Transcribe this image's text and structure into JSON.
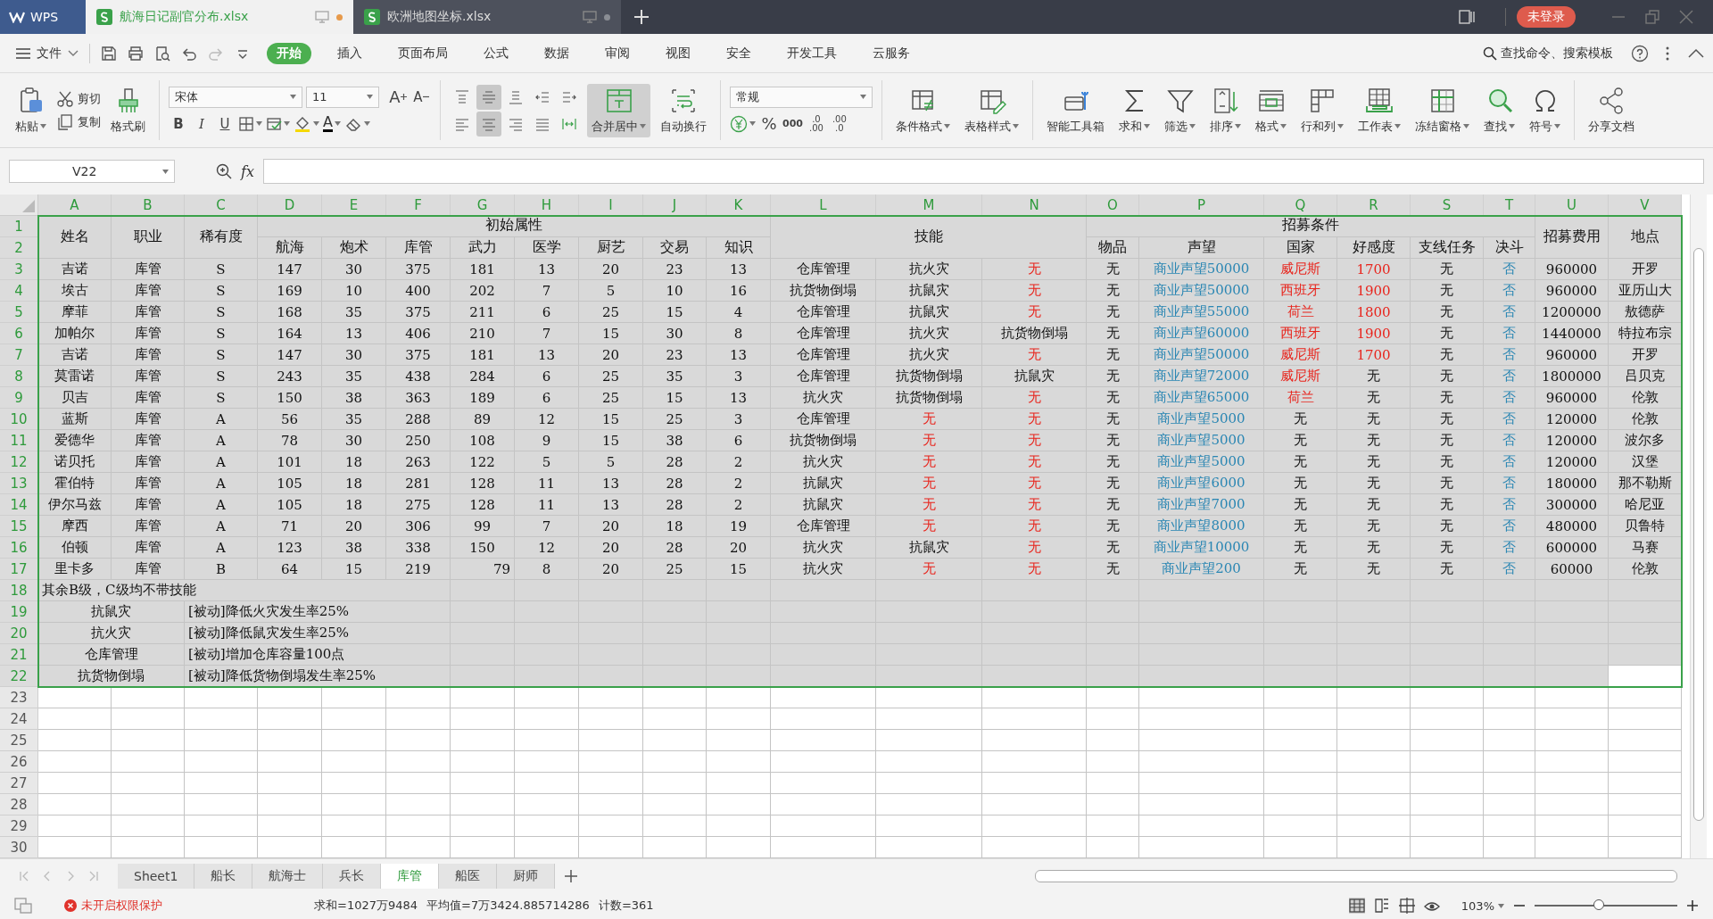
{
  "title_bar": {
    "app": "WPS",
    "tabs": [
      {
        "label": "航海日记副官分布.xlsx",
        "selected": true,
        "unsaved": true
      },
      {
        "label": "欧洲地图坐标.xlsx",
        "selected": false,
        "unsaved": false
      }
    ],
    "login": "未登录"
  },
  "menu_bar": {
    "file": "文件",
    "tabs": [
      {
        "label": "开始",
        "selected": true
      },
      {
        "label": "插入",
        "selected": false
      },
      {
        "label": "页面布局",
        "selected": false
      },
      {
        "label": "公式",
        "selected": false
      },
      {
        "label": "数据",
        "selected": false
      },
      {
        "label": "审阅",
        "selected": false
      },
      {
        "label": "视图",
        "selected": false
      },
      {
        "label": "安全",
        "selected": false
      },
      {
        "label": "开发工具",
        "selected": false
      },
      {
        "label": "云服务",
        "selected": false
      }
    ],
    "search": "查找命令、搜索模板"
  },
  "ribbon": {
    "paste": "粘贴",
    "cut": "剪切",
    "copy": "复制",
    "format_painter": "格式刷",
    "font": "宋体",
    "font_size": "11",
    "grow_font": "A",
    "shrink_font": "A",
    "styles": [
      {
        "label": "B",
        "kind": "bold"
      },
      {
        "label": "I",
        "kind": "italic"
      },
      {
        "label": "U",
        "kind": "underline"
      }
    ],
    "font_color": "A",
    "alignment": [
      {
        "kind": "top",
        "selected": false
      },
      {
        "kind": "middle",
        "selected": true
      },
      {
        "kind": "bottom",
        "selected": false
      },
      {
        "kind": "outdent",
        "selected": false
      },
      {
        "kind": "indent",
        "selected": false
      },
      {
        "kind": "left",
        "selected": false
      },
      {
        "kind": "center",
        "selected": true
      },
      {
        "kind": "right",
        "selected": false
      },
      {
        "kind": "justify",
        "selected": false
      },
      {
        "kind": "distributed",
        "selected": false
      }
    ],
    "merge": {
      "label": "合并居中",
      "selected": true
    },
    "wrap": {
      "label": "自动换行",
      "selected": false
    },
    "number_format": "常规",
    "percent": "%",
    "thousands": "000",
    "decimals": [
      {
        "top": ".0",
        "bottom": ".00"
      },
      {
        "top": ".00",
        "bottom": ".0"
      }
    ],
    "tools": [
      {
        "label": "条件格式",
        "kind": "conditional",
        "has_menu": true
      },
      {
        "label": "表格样式",
        "kind": "table_style",
        "has_menu": true
      },
      {
        "label": "智能工具箱",
        "kind": "toolbox",
        "has_menu": false
      },
      {
        "label": "求和",
        "kind": "sum",
        "has_menu": true
      },
      {
        "label": "筛选",
        "kind": "filter",
        "has_menu": true
      },
      {
        "label": "排序",
        "kind": "sort",
        "has_menu": true
      },
      {
        "label": "格式",
        "kind": "format",
        "has_menu": true
      },
      {
        "label": "行和列",
        "kind": "rows_cols",
        "has_menu": true
      },
      {
        "label": "工作表",
        "kind": "worksheet",
        "has_menu": true
      },
      {
        "label": "冻结窗格",
        "kind": "freeze",
        "has_menu": true
      },
      {
        "label": "查找",
        "kind": "find",
        "has_menu": true
      },
      {
        "label": "符号",
        "kind": "symbol",
        "has_menu": true
      },
      {
        "label": "分享文档",
        "kind": "share",
        "has_menu": false
      }
    ]
  },
  "formula_bar": {
    "cell": "V22",
    "fx": "fx"
  },
  "sheet": {
    "columns": [
      {
        "letter": "A",
        "selected": true
      },
      {
        "letter": "B",
        "selected": true
      },
      {
        "letter": "C",
        "selected": true
      },
      {
        "letter": "D",
        "selected": true
      },
      {
        "letter": "E",
        "selected": true
      },
      {
        "letter": "F",
        "selected": true
      },
      {
        "letter": "G",
        "selected": true
      },
      {
        "letter": "H",
        "selected": true
      },
      {
        "letter": "I",
        "selected": true
      },
      {
        "letter": "J",
        "selected": true
      },
      {
        "letter": "K",
        "selected": true
      },
      {
        "letter": "L",
        "selected": true
      },
      {
        "letter": "M",
        "selected": true
      },
      {
        "letter": "N",
        "selected": true
      },
      {
        "letter": "O",
        "selected": true
      },
      {
        "letter": "P",
        "selected": true
      },
      {
        "letter": "Q",
        "selected": true
      },
      {
        "letter": "R",
        "selected": true
      },
      {
        "letter": "S",
        "selected": true
      },
      {
        "letter": "T",
        "selected": true
      },
      {
        "letter": "U",
        "selected": true
      },
      {
        "letter": "V",
        "selected": true
      }
    ],
    "rows": [
      {
        "number": "1",
        "selected": true
      },
      {
        "number": "2",
        "selected": true
      },
      {
        "number": "3",
        "selected": true
      },
      {
        "number": "4",
        "selected": true
      },
      {
        "number": "5",
        "selected": true
      },
      {
        "number": "6",
        "selected": true
      },
      {
        "number": "7",
        "selected": true
      },
      {
        "number": "8",
        "selected": true
      },
      {
        "number": "9",
        "selected": true
      },
      {
        "number": "10",
        "selected": true
      },
      {
        "number": "11",
        "selected": true
      },
      {
        "number": "12",
        "selected": true
      },
      {
        "number": "13",
        "selected": true
      },
      {
        "number": "14",
        "selected": true
      },
      {
        "number": "15",
        "selected": true
      },
      {
        "number": "16",
        "selected": true
      },
      {
        "number": "17",
        "selected": true
      },
      {
        "number": "18",
        "selected": true
      },
      {
        "number": "19",
        "selected": true
      },
      {
        "number": "20",
        "selected": true
      },
      {
        "number": "21",
        "selected": true
      },
      {
        "number": "22",
        "selected": true
      },
      {
        "number": "23",
        "selected": false
      },
      {
        "number": "24",
        "selected": false
      },
      {
        "number": "25",
        "selected": false
      },
      {
        "number": "26",
        "selected": false
      },
      {
        "number": "27",
        "selected": false
      },
      {
        "number": "28",
        "selected": false
      },
      {
        "number": "29",
        "selected": false
      },
      {
        "number": "30",
        "selected": false
      }
    ],
    "header_cells": [
      "姓名",
      "职业",
      "稀有度",
      "初始属性",
      "航海",
      "炮术",
      "库管",
      "武力",
      "医学",
      "厨艺",
      "交易",
      "知识",
      "技能",
      "招募条件",
      "物品",
      "声望",
      "国家",
      "好感度",
      "支线任务",
      "决斗",
      "招募费用",
      "地点"
    ],
    "data_rows": [
      [
        {
          "text": "吉诺"
        },
        {
          "text": "库管"
        },
        {
          "text": "S"
        },
        {
          "text": "147"
        },
        {
          "text": "30"
        },
        {
          "text": "375"
        },
        {
          "text": "181"
        },
        {
          "text": "13"
        },
        {
          "text": "20"
        },
        {
          "text": "23"
        },
        {
          "text": "13"
        },
        {
          "text": "仓库管理"
        },
        {
          "text": "抗火灾"
        },
        {
          "text": "无",
          "color": "#e8241c"
        },
        {
          "text": "无"
        },
        {
          "text": "商业声望50000",
          "color": "#2a86b3"
        },
        {
          "text": "威尼斯",
          "color": "#e8241c"
        },
        {
          "text": "1700",
          "color": "#e8241c"
        },
        {
          "text": "无"
        },
        {
          "text": "否",
          "color": "#2a86b3"
        },
        {
          "text": "960000"
        },
        {
          "text": "开罗"
        }
      ],
      [
        {
          "text": "埃古"
        },
        {
          "text": "库管"
        },
        {
          "text": "S"
        },
        {
          "text": "169"
        },
        {
          "text": "10"
        },
        {
          "text": "400"
        },
        {
          "text": "202"
        },
        {
          "text": "7"
        },
        {
          "text": "5"
        },
        {
          "text": "10"
        },
        {
          "text": "16"
        },
        {
          "text": "抗货物倒塌"
        },
        {
          "text": "抗鼠灾"
        },
        {
          "text": "无",
          "color": "#e8241c"
        },
        {
          "text": "无"
        },
        {
          "text": "商业声望50000",
          "color": "#2a86b3"
        },
        {
          "text": "西班牙",
          "color": "#e8241c"
        },
        {
          "text": "1900",
          "color": "#e8241c"
        },
        {
          "text": "无"
        },
        {
          "text": "否",
          "color": "#2a86b3"
        },
        {
          "text": "960000"
        },
        {
          "text": "亚历山大"
        }
      ],
      [
        {
          "text": "摩菲"
        },
        {
          "text": "库管"
        },
        {
          "text": "S"
        },
        {
          "text": "168"
        },
        {
          "text": "35"
        },
        {
          "text": "375"
        },
        {
          "text": "211"
        },
        {
          "text": "6"
        },
        {
          "text": "25"
        },
        {
          "text": "15"
        },
        {
          "text": "4"
        },
        {
          "text": "仓库管理"
        },
        {
          "text": "抗鼠灾"
        },
        {
          "text": "无",
          "color": "#e8241c"
        },
        {
          "text": "无"
        },
        {
          "text": "商业声望55000",
          "color": "#2a86b3"
        },
        {
          "text": "荷兰",
          "color": "#e8241c"
        },
        {
          "text": "1800",
          "color": "#e8241c"
        },
        {
          "text": "无"
        },
        {
          "text": "否",
          "color": "#2a86b3"
        },
        {
          "text": "1200000"
        },
        {
          "text": "敖德萨"
        }
      ],
      [
        {
          "text": "加帕尔"
        },
        {
          "text": "库管"
        },
        {
          "text": "S"
        },
        {
          "text": "164"
        },
        {
          "text": "13"
        },
        {
          "text": "406"
        },
        {
          "text": "210"
        },
        {
          "text": "7"
        },
        {
          "text": "15"
        },
        {
          "text": "30"
        },
        {
          "text": "8"
        },
        {
          "text": "仓库管理"
        },
        {
          "text": "抗火灾"
        },
        {
          "text": "抗货物倒塌"
        },
        {
          "text": "无"
        },
        {
          "text": "商业声望60000",
          "color": "#2a86b3"
        },
        {
          "text": "西班牙",
          "color": "#e8241c"
        },
        {
          "text": "1900",
          "color": "#e8241c"
        },
        {
          "text": "无"
        },
        {
          "text": "否",
          "color": "#2a86b3"
        },
        {
          "text": "1440000"
        },
        {
          "text": "特拉布宗"
        }
      ],
      [
        {
          "text": "吉诺"
        },
        {
          "text": "库管"
        },
        {
          "text": "S"
        },
        {
          "text": "147"
        },
        {
          "text": "30"
        },
        {
          "text": "375"
        },
        {
          "text": "181"
        },
        {
          "text": "13"
        },
        {
          "text": "20"
        },
        {
          "text": "23"
        },
        {
          "text": "13"
        },
        {
          "text": "仓库管理"
        },
        {
          "text": "抗火灾"
        },
        {
          "text": "无",
          "color": "#e8241c"
        },
        {
          "text": "无"
        },
        {
          "text": "商业声望50000",
          "color": "#2a86b3"
        },
        {
          "text": "威尼斯",
          "color": "#e8241c"
        },
        {
          "text": "1700",
          "color": "#e8241c"
        },
        {
          "text": "无"
        },
        {
          "text": "否",
          "color": "#2a86b3"
        },
        {
          "text": "960000"
        },
        {
          "text": "开罗"
        }
      ],
      [
        {
          "text": "莫雷诺"
        },
        {
          "text": "库管"
        },
        {
          "text": "S"
        },
        {
          "text": "243"
        },
        {
          "text": "35"
        },
        {
          "text": "438"
        },
        {
          "text": "284"
        },
        {
          "text": "6"
        },
        {
          "text": "25"
        },
        {
          "text": "35"
        },
        {
          "text": "3"
        },
        {
          "text": "仓库管理"
        },
        {
          "text": "抗货物倒塌"
        },
        {
          "text": "抗鼠灾"
        },
        {
          "text": "无"
        },
        {
          "text": "商业声望72000",
          "color": "#2a86b3"
        },
        {
          "text": "威尼斯",
          "color": "#e8241c"
        },
        {
          "text": "无"
        },
        {
          "text": "无"
        },
        {
          "text": "否",
          "color": "#2a86b3"
        },
        {
          "text": "1800000"
        },
        {
          "text": "吕贝克"
        }
      ],
      [
        {
          "text": "贝吉"
        },
        {
          "text": "库管"
        },
        {
          "text": "S"
        },
        {
          "text": "150"
        },
        {
          "text": "38"
        },
        {
          "text": "363"
        },
        {
          "text": "189"
        },
        {
          "text": "6"
        },
        {
          "text": "25"
        },
        {
          "text": "15"
        },
        {
          "text": "13"
        },
        {
          "text": "抗火灾"
        },
        {
          "text": "抗货物倒塌"
        },
        {
          "text": "无",
          "color": "#e8241c"
        },
        {
          "text": "无"
        },
        {
          "text": "商业声望65000",
          "color": "#2a86b3"
        },
        {
          "text": "荷兰",
          "color": "#e8241c"
        },
        {
          "text": "无"
        },
        {
          "text": "无"
        },
        {
          "text": "否",
          "color": "#2a86b3"
        },
        {
          "text": "960000"
        },
        {
          "text": "伦敦"
        }
      ],
      [
        {
          "text": "蓝斯"
        },
        {
          "text": "库管"
        },
        {
          "text": "A"
        },
        {
          "text": "56"
        },
        {
          "text": "35"
        },
        {
          "text": "288"
        },
        {
          "text": "89"
        },
        {
          "text": "12"
        },
        {
          "text": "15"
        },
        {
          "text": "25"
        },
        {
          "text": "3"
        },
        {
          "text": "仓库管理"
        },
        {
          "text": "无",
          "color": "#e8241c"
        },
        {
          "text": "无",
          "color": "#e8241c"
        },
        {
          "text": "无"
        },
        {
          "text": "商业声望5000",
          "color": "#2a86b3"
        },
        {
          "text": "无"
        },
        {
          "text": "无"
        },
        {
          "text": "无"
        },
        {
          "text": "否",
          "color": "#2a86b3"
        },
        {
          "text": "120000"
        },
        {
          "text": "伦敦"
        }
      ],
      [
        {
          "text": "爱德华"
        },
        {
          "text": "库管"
        },
        {
          "text": "A"
        },
        {
          "text": "78"
        },
        {
          "text": "30"
        },
        {
          "text": "250"
        },
        {
          "text": "108"
        },
        {
          "text": "9"
        },
        {
          "text": "15"
        },
        {
          "text": "38"
        },
        {
          "text": "6"
        },
        {
          "text": "抗货物倒塌"
        },
        {
          "text": "无",
          "color": "#e8241c"
        },
        {
          "text": "无",
          "color": "#e8241c"
        },
        {
          "text": "无"
        },
        {
          "text": "商业声望5000",
          "color": "#2a86b3"
        },
        {
          "text": "无"
        },
        {
          "text": "无"
        },
        {
          "text": "无"
        },
        {
          "text": "否",
          "color": "#2a86b3"
        },
        {
          "text": "120000"
        },
        {
          "text": "波尔多"
        }
      ],
      [
        {
          "text": "诺贝托"
        },
        {
          "text": "库管"
        },
        {
          "text": "A"
        },
        {
          "text": "101"
        },
        {
          "text": "18"
        },
        {
          "text": "263"
        },
        {
          "text": "122"
        },
        {
          "text": "5"
        },
        {
          "text": "5"
        },
        {
          "text": "28"
        },
        {
          "text": "2"
        },
        {
          "text": "抗火灾"
        },
        {
          "text": "无",
          "color": "#e8241c"
        },
        {
          "text": "无",
          "color": "#e8241c"
        },
        {
          "text": "无"
        },
        {
          "text": "商业声望5000",
          "color": "#2a86b3"
        },
        {
          "text": "无"
        },
        {
          "text": "无"
        },
        {
          "text": "无"
        },
        {
          "text": "否",
          "color": "#2a86b3"
        },
        {
          "text": "120000"
        },
        {
          "text": "汉堡"
        }
      ],
      [
        {
          "text": "霍伯特"
        },
        {
          "text": "库管"
        },
        {
          "text": "A"
        },
        {
          "text": "105"
        },
        {
          "text": "18"
        },
        {
          "text": "281"
        },
        {
          "text": "128"
        },
        {
          "text": "11"
        },
        {
          "text": "13"
        },
        {
          "text": "28"
        },
        {
          "text": "2"
        },
        {
          "text": "抗鼠灾"
        },
        {
          "text": "无",
          "color": "#e8241c"
        },
        {
          "text": "无",
          "color": "#e8241c"
        },
        {
          "text": "无"
        },
        {
          "text": "商业声望6000",
          "color": "#2a86b3"
        },
        {
          "text": "无"
        },
        {
          "text": "无"
        },
        {
          "text": "无"
        },
        {
          "text": "否",
          "color": "#2a86b3"
        },
        {
          "text": "180000"
        },
        {
          "text": "那不勒斯"
        }
      ],
      [
        {
          "text": "伊尔马兹"
        },
        {
          "text": "库管"
        },
        {
          "text": "A"
        },
        {
          "text": "105"
        },
        {
          "text": "18"
        },
        {
          "text": "275"
        },
        {
          "text": "128"
        },
        {
          "text": "11"
        },
        {
          "text": "13"
        },
        {
          "text": "28"
        },
        {
          "text": "2"
        },
        {
          "text": "抗鼠灾"
        },
        {
          "text": "无",
          "color": "#e8241c"
        },
        {
          "text": "无",
          "color": "#e8241c"
        },
        {
          "text": "无"
        },
        {
          "text": "商业声望7000",
          "color": "#2a86b3"
        },
        {
          "text": "无"
        },
        {
          "text": "无"
        },
        {
          "text": "无"
        },
        {
          "text": "否",
          "color": "#2a86b3"
        },
        {
          "text": "300000"
        },
        {
          "text": "哈尼亚"
        }
      ],
      [
        {
          "text": "摩西"
        },
        {
          "text": "库管"
        },
        {
          "text": "A"
        },
        {
          "text": "71"
        },
        {
          "text": "20"
        },
        {
          "text": "306"
        },
        {
          "text": "99"
        },
        {
          "text": "7"
        },
        {
          "text": "20"
        },
        {
          "text": "18"
        },
        {
          "text": "19"
        },
        {
          "text": "仓库管理"
        },
        {
          "text": "无",
          "color": "#e8241c"
        },
        {
          "text": "无",
          "color": "#e8241c"
        },
        {
          "text": "无"
        },
        {
          "text": "商业声望8000",
          "color": "#2a86b3"
        },
        {
          "text": "无"
        },
        {
          "text": "无"
        },
        {
          "text": "无"
        },
        {
          "text": "否",
          "color": "#2a86b3"
        },
        {
          "text": "480000"
        },
        {
          "text": "贝鲁特"
        }
      ],
      [
        {
          "text": "伯顿"
        },
        {
          "text": "库管"
        },
        {
          "text": "A"
        },
        {
          "text": "123"
        },
        {
          "text": "38"
        },
        {
          "text": "338"
        },
        {
          "text": "150"
        },
        {
          "text": "12"
        },
        {
          "text": "20"
        },
        {
          "text": "28"
        },
        {
          "text": "20"
        },
        {
          "text": "抗火灾"
        },
        {
          "text": "抗鼠灾"
        },
        {
          "text": "无",
          "color": "#e8241c"
        },
        {
          "text": "无"
        },
        {
          "text": "商业声望10000",
          "color": "#2a86b3"
        },
        {
          "text": "无"
        },
        {
          "text": "无"
        },
        {
          "text": "无"
        },
        {
          "text": "否",
          "color": "#2a86b3"
        },
        {
          "text": "600000"
        },
        {
          "text": "马赛"
        }
      ],
      [
        {
          "text": "里卡多"
        },
        {
          "text": "库管"
        },
        {
          "text": "B"
        },
        {
          "text": "64"
        },
        {
          "text": "15"
        },
        {
          "text": "219"
        },
        {
          "text": "79",
          "numeric": true
        },
        {
          "text": "8"
        },
        {
          "text": "20"
        },
        {
          "text": "25"
        },
        {
          "text": "15"
        },
        {
          "text": "抗火灾"
        },
        {
          "text": "无",
          "color": "#e8241c"
        },
        {
          "text": "无",
          "color": "#e8241c"
        },
        {
          "text": "无"
        },
        {
          "text": "商业声望200",
          "color": "#2a86b3"
        },
        {
          "text": "无"
        },
        {
          "text": "无"
        },
        {
          "text": "无"
        },
        {
          "text": "否",
          "color": "#2a86b3"
        },
        {
          "text": "60000"
        },
        {
          "text": "伦敦"
        }
      ]
    ],
    "note_cells": [
      {
        "text": "其余B级，C级均不带技能",
        "kind": "left"
      },
      {
        "text": "抗鼠灾",
        "kind": "center"
      },
      {
        "text": "[被动]降低火灾发生率25%",
        "kind": "left"
      },
      {
        "text": "抗火灾",
        "kind": "center"
      },
      {
        "text": "[被动]降低鼠灾发生率25%",
        "kind": "left"
      },
      {
        "text": "仓库管理",
        "kind": "center"
      },
      {
        "text": "[被动]增加仓库容量100点",
        "kind": "left"
      },
      {
        "text": "抗货物倒塌",
        "kind": "center"
      },
      {
        "text": "[被动]降低货物倒塌发生率25%",
        "kind": "left"
      }
    ]
  },
  "sheet_tabs": [
    {
      "label": "Sheet1",
      "selected": false
    },
    {
      "label": "船长",
      "selected": false
    },
    {
      "label": "航海士",
      "selected": false
    },
    {
      "label": "兵长",
      "selected": false
    },
    {
      "label": "库管",
      "selected": true
    },
    {
      "label": "船医",
      "selected": false
    },
    {
      "label": "厨师",
      "selected": false
    }
  ],
  "status_bar": {
    "protection": "未开启权限保护",
    "sum": "求和=1027万9484",
    "average": "平均值=7万3424.885714286",
    "count": "计数=361",
    "zoom": "103%",
    "zoom_slider": {
      "level": 0.45
    }
  }
}
